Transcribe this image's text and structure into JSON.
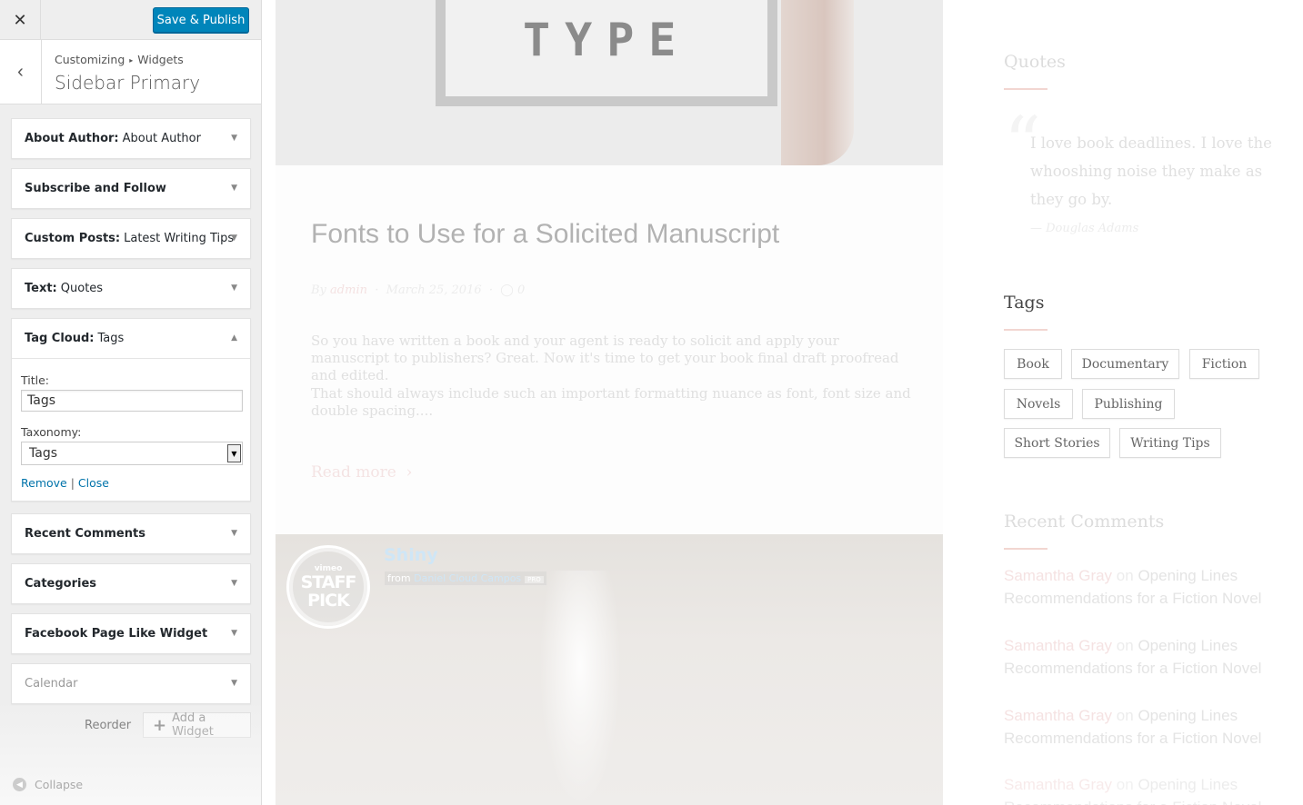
{
  "customizer": {
    "close_glyph": "✕",
    "save_publish": "Save & Publish",
    "back_glyph": "‹",
    "breadcrumb": {
      "part1": "Customizing",
      "separator": "▸",
      "part2": "Widgets"
    },
    "section_title": "Sidebar Primary",
    "widgets": [
      {
        "bold": "About Author:",
        "sub": "About Author",
        "arrow": "▼"
      },
      {
        "bold": "Subscribe and Follow",
        "sub": "",
        "arrow": "▼"
      },
      {
        "bold": "Custom Posts:",
        "sub": "Latest Writing Tips",
        "arrow": "▼"
      },
      {
        "bold": "Text:",
        "sub": "Quotes",
        "arrow": "▼"
      },
      {
        "bold": "Tag Cloud:",
        "sub": "Tags",
        "arrow": "▲"
      },
      {
        "bold": "Recent Comments",
        "sub": "",
        "arrow": "▼"
      },
      {
        "bold": "Categories",
        "sub": "",
        "arrow": "▼"
      },
      {
        "bold": "Facebook Page Like Widget",
        "sub": "",
        "arrow": "▼"
      },
      {
        "bold": "Calendar",
        "sub": "",
        "arrow": "▼"
      }
    ],
    "tag_cloud_form": {
      "title_label": "Title:",
      "title_value": "Tags",
      "taxonomy_label": "Taxonomy:",
      "taxonomy_value": "Tags",
      "dropdown_glyph": "▼",
      "remove": "Remove",
      "divider": "|",
      "close": "Close"
    },
    "reorder": "Reorder",
    "add_widget_plus": "+",
    "add_widget": "Add a Widget",
    "collapse_glyph": "◀",
    "collapse": "Collapse"
  },
  "preview": {
    "hero_sign_text": "TYPE",
    "post": {
      "title": "Fonts to Use for a Solicited Manuscript",
      "meta_by": "By",
      "meta_author": "admin",
      "meta_sep1": "·",
      "meta_date": "March 25, 2016",
      "meta_sep2": "·",
      "meta_comment_icon": "◯",
      "meta_comments": "0",
      "excerpt_p1": "So you have written a book and your agent is ready to solicit and apply your manuscript to publishers? Great. Now it's time to get your book final draft proofread and edited.",
      "excerpt_p2": "That should always include such an important formatting nuance as font, font size and double spacing....",
      "read_more": "Read more",
      "read_more_arrow": "›"
    },
    "video": {
      "badge_top": "vimeo",
      "badge_line1": "STAFF",
      "badge_line2": "PICK",
      "title": "Shiny",
      "from": "from",
      "author": "Daniel Cloud Campos",
      "pro": "PRO"
    },
    "sidebar": {
      "quotes_title": "Quotes",
      "quote_mark": "“",
      "quote_text": "I love book deadlines. I love the whooshing noise they make as they go by.",
      "quote_author": "— Douglas Adams",
      "tags_title": "Tags",
      "tags": [
        "Book",
        "Documentary",
        "Fiction",
        "Novels",
        "Publishing",
        "Short Stories",
        "Writing Tips"
      ],
      "recent_comments_title": "Recent Comments",
      "comments": [
        {
          "name": "Samantha Gray",
          "on": "on",
          "link": "Opening Lines Recommendations for a Fiction Novel"
        },
        {
          "name": "Samantha Gray",
          "on": "on",
          "link": "Opening Lines Recommendations for a Fiction Novel"
        },
        {
          "name": "Samantha Gray",
          "on": "on",
          "link": "Opening Lines Recommendations for a Fiction Novel"
        },
        {
          "name": "Samantha Gray",
          "on": "on",
          "link": "Opening Lines Recommendations for a Fiction Novel"
        }
      ]
    }
  }
}
